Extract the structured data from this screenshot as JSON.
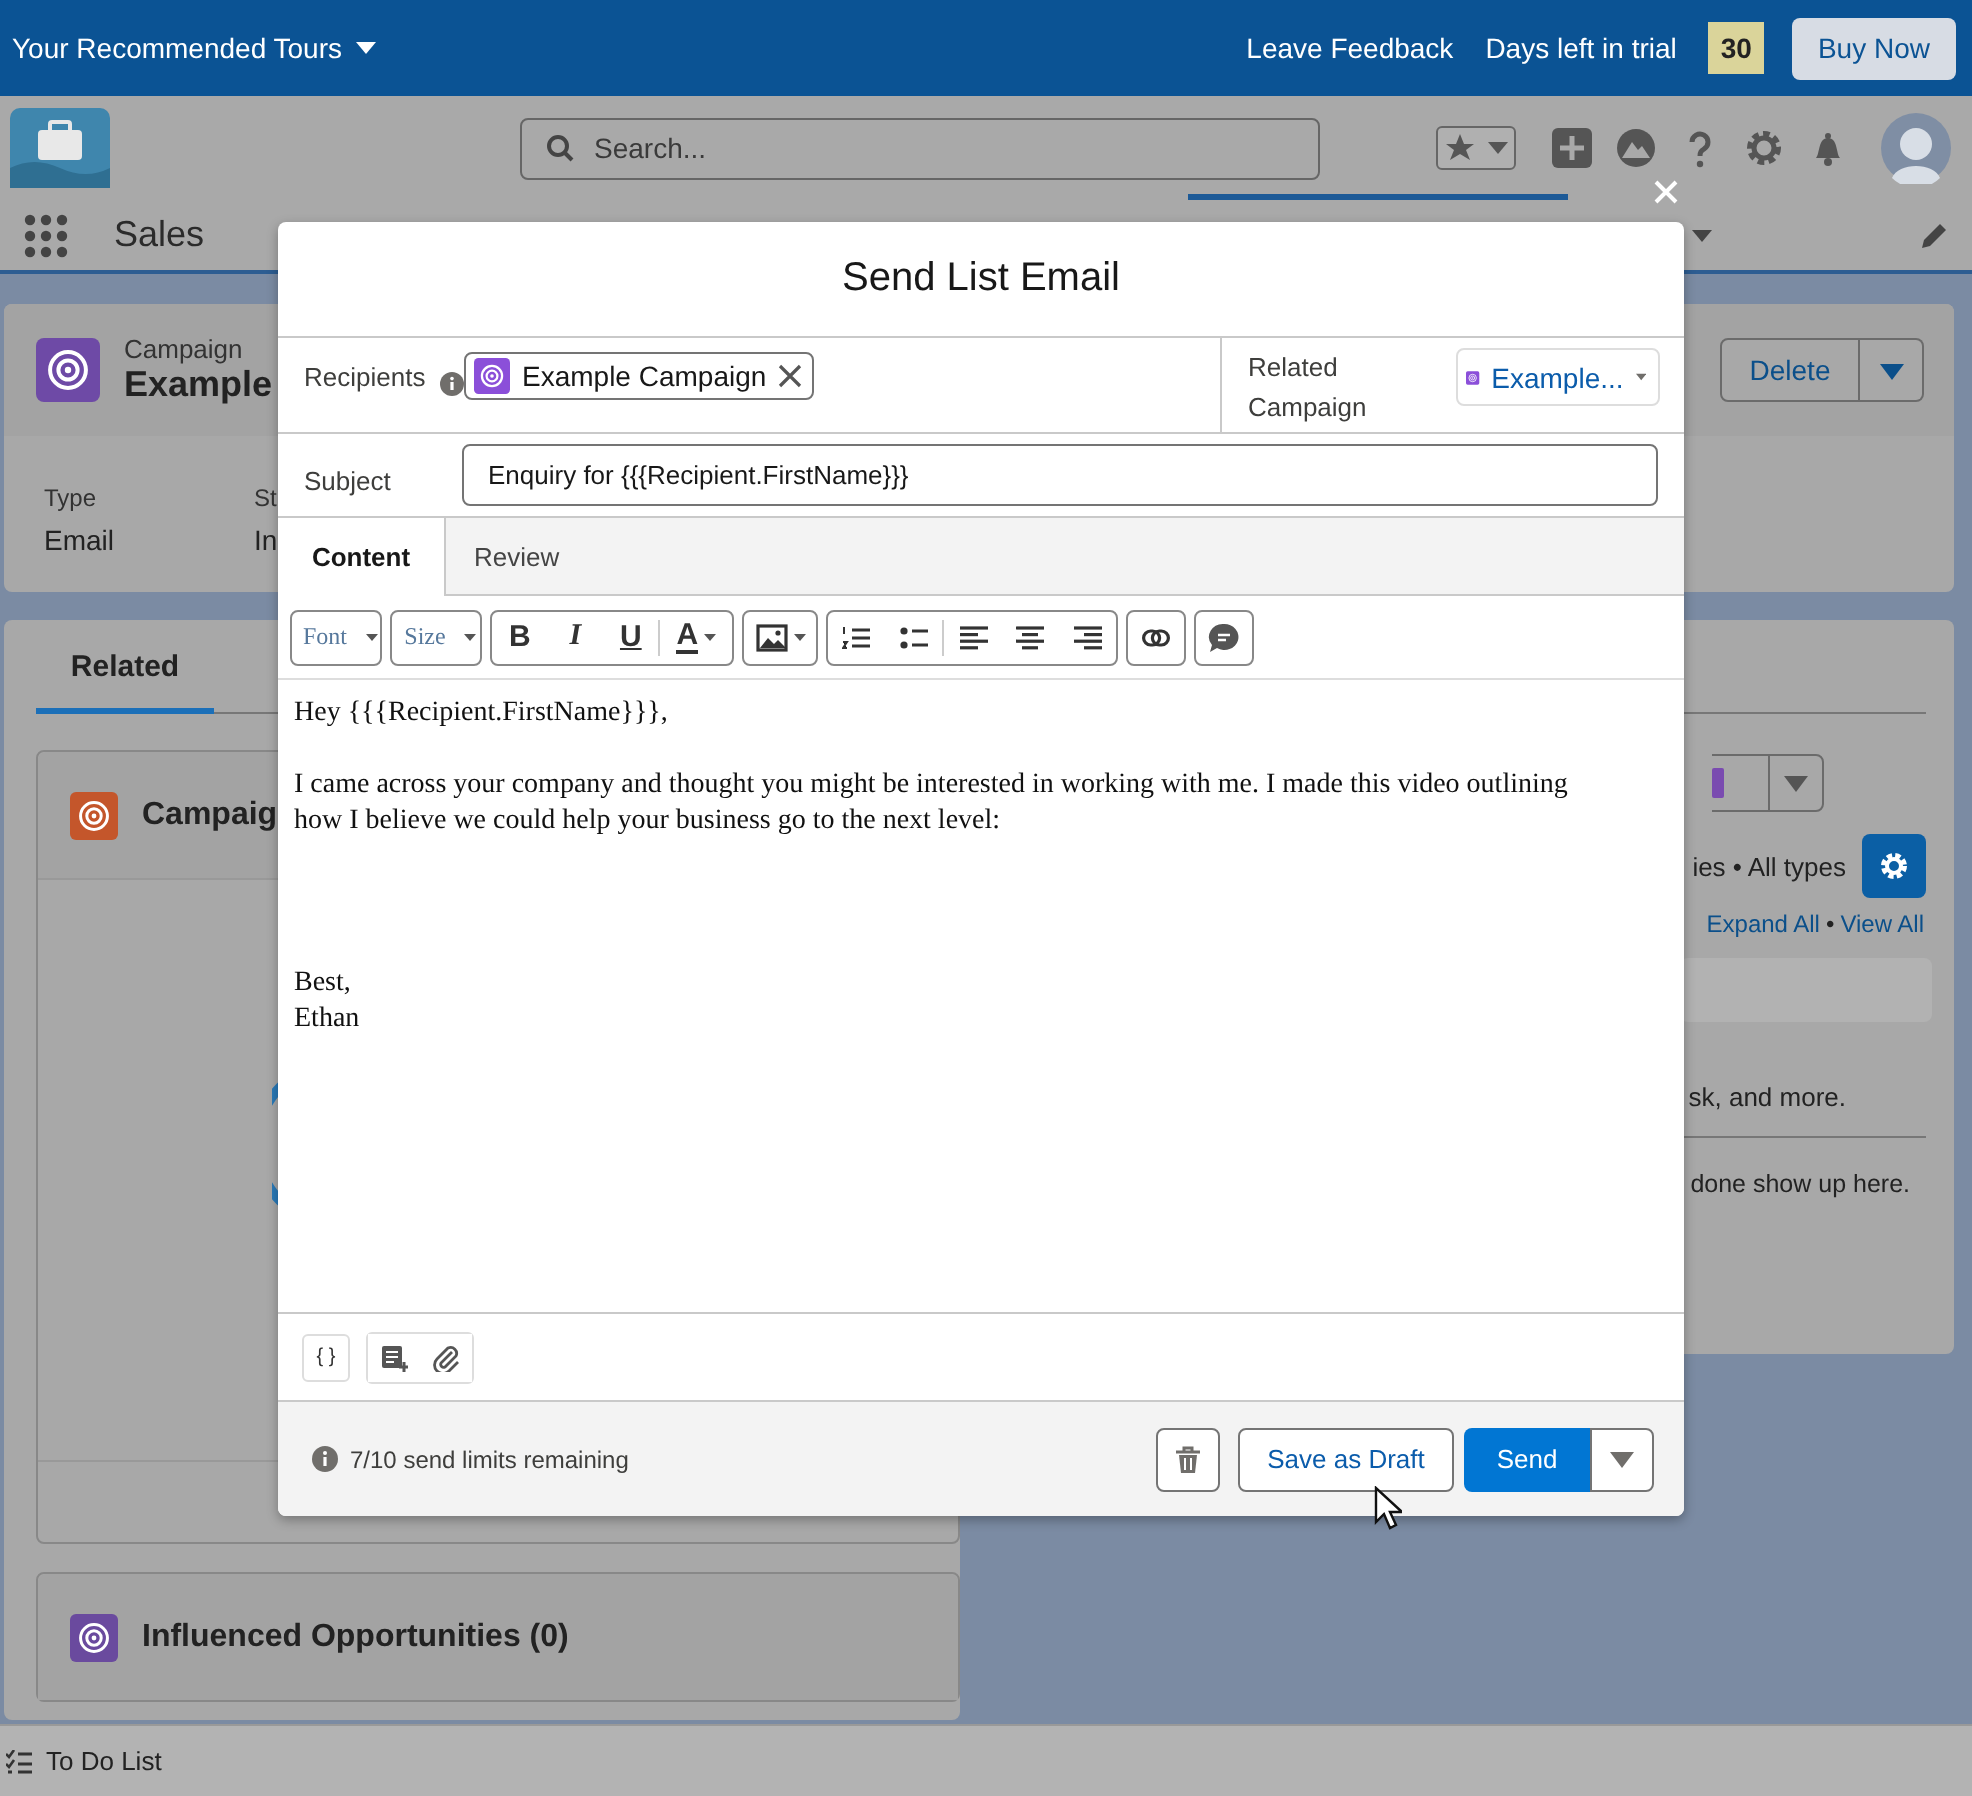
{
  "trial_banner": {
    "tours": "Your Recommended Tours",
    "feedback": "Leave Feedback",
    "days_label": "Days left in trial",
    "days": "30",
    "buy": "Buy Now"
  },
  "search": {
    "placeholder": "Search..."
  },
  "nav": {
    "app_name": "Sales"
  },
  "record": {
    "object": "Campaign",
    "name": "Example",
    "action": "Delete",
    "fields": [
      {
        "label": "Type",
        "value": "Email"
      },
      {
        "label": "St",
        "value": "In"
      }
    ]
  },
  "related_tabs": [
    {
      "label": "Related",
      "selected": true
    }
  ],
  "left_cards": [
    {
      "title": "Campaig",
      "color": "#c4562b"
    },
    {
      "title": "Influenced Opportunities (0)",
      "color": "#6a4a9e"
    }
  ],
  "activity": {
    "filter": "ies • All types",
    "expand": "Expand All",
    "separator": "•",
    "view_all": "View All",
    "hint": "sk, and more.",
    "past": "done show up here."
  },
  "modal": {
    "title": "Send List Email",
    "recipients_label": "Recipients",
    "recipient": "Example Campaign",
    "related_label": "Related Campaign",
    "related_value": "Example...",
    "subject_label": "Subject",
    "subject": "Enquiry for {{{Recipient.FirstName}}}",
    "tabs": [
      {
        "label": "Content",
        "selected": true
      },
      {
        "label": "Review",
        "selected": false
      }
    ],
    "toolbar": {
      "font": "Font",
      "size": "Size",
      "format": [
        "B",
        "I",
        "U"
      ],
      "text_color": "A"
    },
    "body": [
      "Hey {{{Recipient.FirstName}}},",
      "I came across your company and thought you might be interested in working with me. I made this video outlining how I believe we could help your business go to the next level:",
      "Best,\nEthan"
    ],
    "merge_field": "{ }",
    "limits": "7/10 send limits remaining",
    "draft": "Save as Draft",
    "send": "Send"
  },
  "todo": "To Do List"
}
